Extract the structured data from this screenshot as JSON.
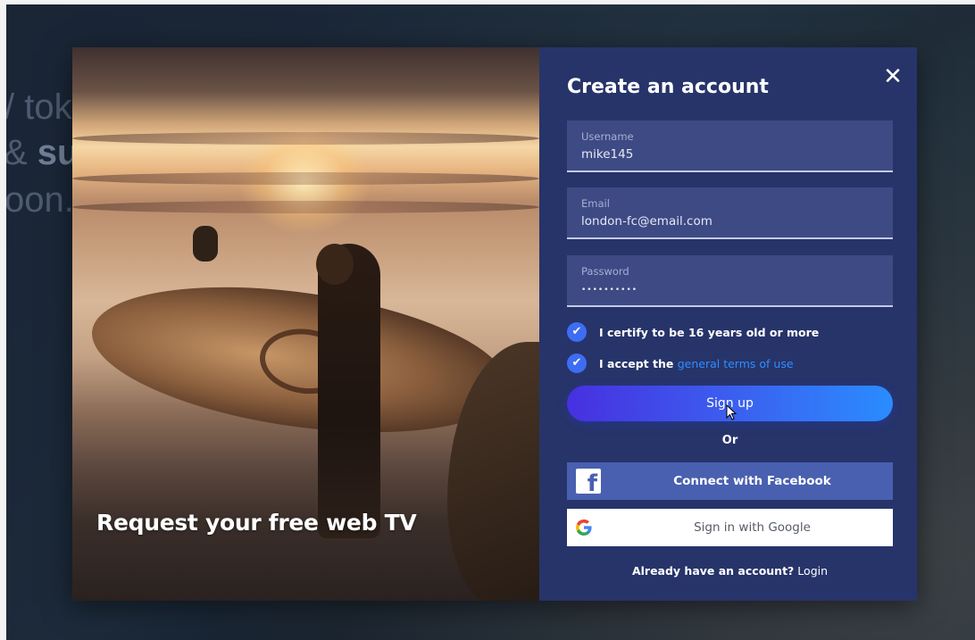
{
  "background": {
    "line1": "/ tok",
    "line2_plain": "& ",
    "line2_bold": "su",
    "line3": "oon."
  },
  "modal": {
    "photo_title": "Request your free web TV",
    "close_label": "✕",
    "title": "Create an account",
    "fields": {
      "username": {
        "label": "Username",
        "value": "mike145"
      },
      "email": {
        "label": "Email",
        "value": "london-fc@email.com"
      },
      "password": {
        "label": "Password",
        "value": "••••••••••"
      }
    },
    "checkboxes": {
      "age": {
        "checked": true,
        "text": "I certify to be 16 years old or more"
      },
      "terms": {
        "checked": true,
        "text": "I accept the ",
        "link": "general terms of use"
      }
    },
    "signup_label": "Sign up",
    "or_label": "Or",
    "facebook": {
      "icon": "facebook-icon",
      "label": "Connect with Facebook"
    },
    "google": {
      "icon": "google-icon",
      "label": "Sign in with Google"
    },
    "login_row": {
      "question": "Already have an account?",
      "link": "Login"
    }
  },
  "colors": {
    "panel": "#27346a",
    "field": "#3e4a83",
    "accent_blue": "#3d6df2",
    "link": "#2f8dff",
    "facebook": "#4960b0",
    "signup_gradient_start": "#4730e0",
    "signup_gradient_end": "#2a8cff"
  }
}
